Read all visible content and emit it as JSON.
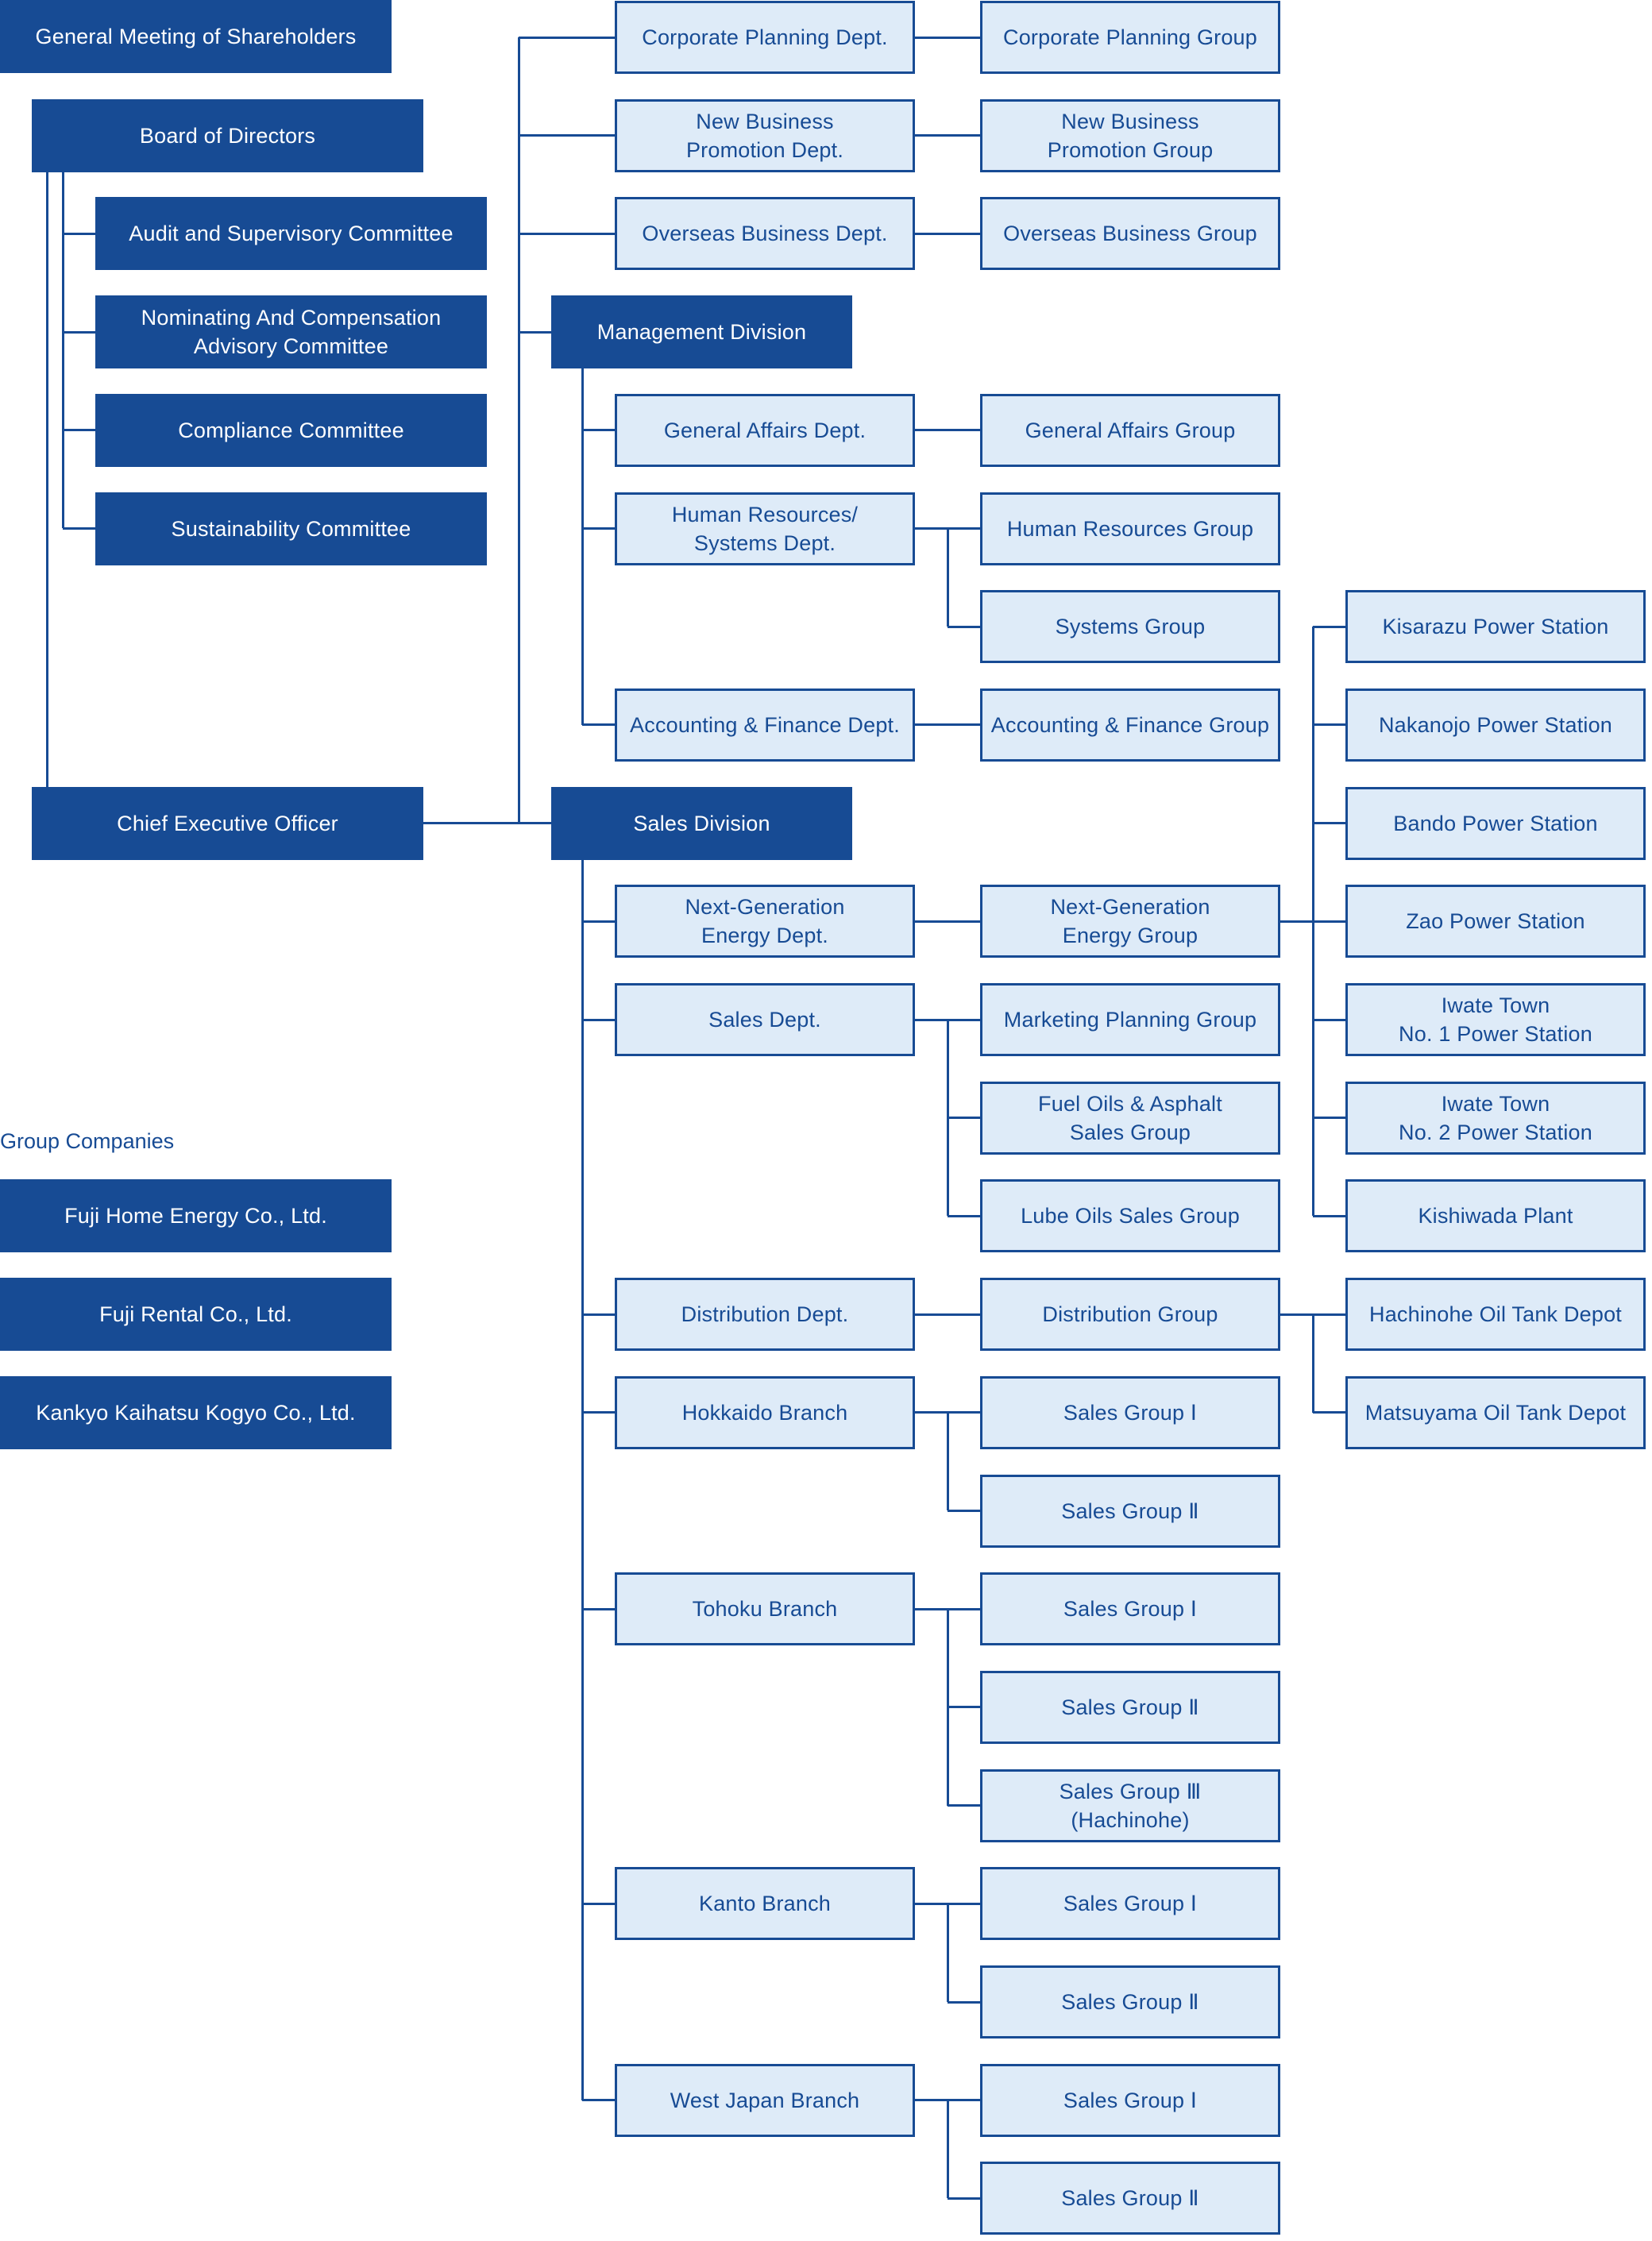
{
  "colors": {
    "dark_fill": "#174b94",
    "light_fill": "#deebf8",
    "line": "#174b94",
    "dark_text": "#ffffff",
    "light_text": "#174b94"
  },
  "top": {
    "general_meeting": "General Meeting of Shareholders",
    "board": "Board of Directors",
    "ceo": "Chief Executive Officer"
  },
  "committees": [
    "Audit and Supervisory Committee",
    "Nominating And Compensation\nAdvisory Committee",
    "Compliance Committee",
    "Sustainability Committee"
  ],
  "direct_depts": [
    {
      "dept": "Corporate Planning Dept.",
      "groups": [
        "Corporate Planning Group"
      ]
    },
    {
      "dept": "New Business\nPromotion Dept.",
      "groups": [
        "New Business\nPromotion Group"
      ]
    },
    {
      "dept": "Overseas Business Dept.",
      "groups": [
        "Overseas Business Group"
      ]
    }
  ],
  "management_division": {
    "label": "Management Division",
    "depts": [
      {
        "dept": "General Affairs Dept.",
        "groups": [
          "General Affairs Group"
        ]
      },
      {
        "dept": "Human Resources/\nSystems Dept.",
        "groups": [
          "Human Resources Group",
          "Systems Group"
        ]
      },
      {
        "dept": "Accounting & Finance Dept.",
        "groups": [
          "Accounting & Finance Group"
        ]
      }
    ]
  },
  "sales_division": {
    "label": "Sales Division",
    "depts": [
      {
        "dept": "Next-Generation\nEnergy Dept.",
        "groups": [
          "Next-Generation\nEnergy Group"
        ]
      },
      {
        "dept": "Sales Dept.",
        "groups": [
          "Marketing Planning Group",
          "Fuel Oils & Asphalt\nSales Group",
          "Lube Oils Sales Group"
        ]
      },
      {
        "dept": "Distribution Dept.",
        "groups": [
          "Distribution Group"
        ]
      },
      {
        "dept": "Hokkaido Branch",
        "groups": [
          "Sales Group Ⅰ",
          "Sales Group Ⅱ"
        ]
      },
      {
        "dept": "Tohoku Branch",
        "groups": [
          "Sales Group Ⅰ",
          "Sales Group Ⅱ",
          "Sales Group Ⅲ\n(Hachinohe)"
        ]
      },
      {
        "dept": "Kanto Branch",
        "groups": [
          "Sales Group Ⅰ",
          "Sales Group Ⅱ"
        ]
      },
      {
        "dept": "West Japan Branch",
        "groups": [
          "Sales Group Ⅰ",
          "Sales Group Ⅱ"
        ]
      }
    ]
  },
  "facilities": {
    "next_generation": [
      "Kisarazu Power Station",
      "Nakanojo Power Station",
      "Bando Power Station",
      "Zao Power Station",
      "Iwate Town\nNo. 1 Power Station",
      "Iwate Town\nNo. 2 Power Station",
      "Kishiwada Plant"
    ],
    "distribution": [
      "Hachinohe Oil Tank Depot",
      "Matsuyama Oil Tank Depot"
    ]
  },
  "group_companies": {
    "label": "Group Companies",
    "items": [
      "Fuji Home Energy Co., Ltd.",
      "Fuji Rental Co., Ltd.",
      "Kankyo Kaihatsu Kogyo Co., Ltd."
    ]
  }
}
